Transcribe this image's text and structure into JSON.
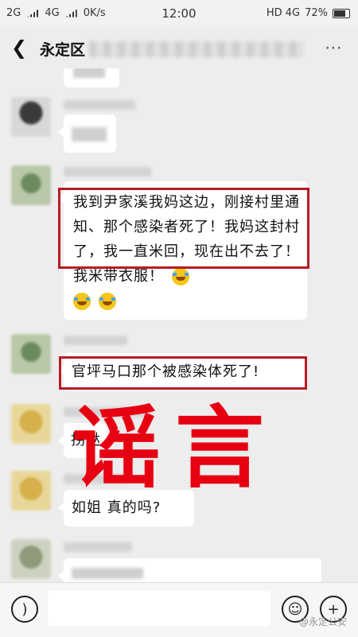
{
  "status_bar": {
    "left_items": [
      "2G",
      "4G",
      "0K/s"
    ],
    "time": "12:00",
    "network": "HD 4G",
    "battery": "72%"
  },
  "header": {
    "title": "永定区",
    "back_icon": "chevron-left-icon",
    "more_icon": "more-dots-icon"
  },
  "messages": [
    {
      "text": "我到尹家溪我妈这边，刚接村里通知、那个感染者死了！我妈这封村了，我一直米回，现在出不去了！我米带衣服！",
      "emoji_count": 3,
      "highlighted": true
    },
    {
      "text": "官坪马口那个被感染体死了!",
      "highlighted": true
    },
    {
      "text": "拐哒"
    },
    {
      "text": "如姐 真的吗?"
    }
  ],
  "stamp": {
    "text": "谣言",
    "color": "#e60012"
  },
  "input_bar": {
    "voice_icon": "voice-icon",
    "emoji_icon": "emoji-icon",
    "plus_icon": "plus-icon"
  },
  "watermark": "@永定公安",
  "colors": {
    "highlight_border": "#b81c22",
    "background": "#ededed"
  }
}
